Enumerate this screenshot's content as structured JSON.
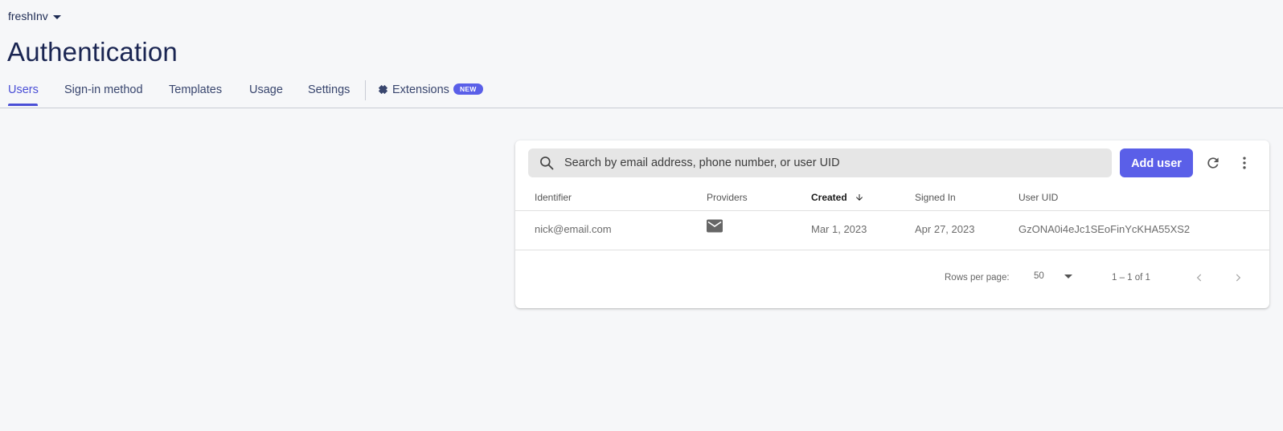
{
  "header": {
    "project_name": "freshInv",
    "title": "Authentication"
  },
  "tabs": [
    {
      "label": "Users",
      "active": true
    },
    {
      "label": "Sign-in method",
      "active": false
    },
    {
      "label": "Templates",
      "active": false
    },
    {
      "label": "Usage",
      "active": false
    },
    {
      "label": "Settings",
      "active": false
    },
    {
      "label": "Extensions",
      "active": false,
      "badge": "NEW",
      "icon": "extensions-icon"
    }
  ],
  "users_panel": {
    "search": {
      "placeholder": "Search by email address, phone number, or user UID",
      "value": ""
    },
    "add_user_label": "Add user",
    "columns": [
      "Identifier",
      "Providers",
      "Created",
      "Signed In",
      "User UID"
    ],
    "sorted_column": "Created",
    "sort_direction": "descending",
    "rows": [
      {
        "identifier": "nick@email.com",
        "provider_icon": "email-icon",
        "created": "Mar 1, 2023",
        "signed_in": "Apr 27, 2023",
        "uid": "GzONA0i4eJc1SEoFinYcKHA55XS2"
      }
    ],
    "pagination": {
      "rows_per_page_label": "Rows per page:",
      "rows_per_page": "50",
      "range": "1 – 1 of 1"
    }
  },
  "colors": {
    "accent": "#5a5fe8",
    "active_tab": "#4a4fd6",
    "background": "#f6f7f9"
  }
}
